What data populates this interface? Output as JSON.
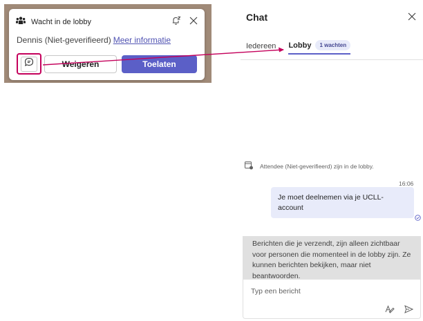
{
  "lobby_card": {
    "title": "Wacht in de lobby",
    "person": "Dennis (Niet-geverifieerd)",
    "more_info": "Meer informatie",
    "deny": "Weigeren",
    "admit": "Toelaten"
  },
  "chat": {
    "title": "Chat",
    "tabs": {
      "everyone": "Iedereen",
      "lobby": "Lobby",
      "lobby_badge": "1 wachten"
    },
    "system_message": "Attendee (Niet-geverifieerd) zijn in de lobby.",
    "message_time": "16:06",
    "message_text": "Je moet deelnemen via je UCLL-account",
    "notice": "Berichten die je verzendt, zijn alleen zichtbaar voor personen die momenteel in de lobby zijn. Ze kunnen berichten bekijken, maar niet beantwoorden.",
    "compose_placeholder": "Typ een bericht"
  },
  "colors": {
    "accent": "#5b5fc7",
    "highlight": "#c4005b",
    "bubble": "#e8ebfa",
    "notice": "#e0e0e0"
  }
}
